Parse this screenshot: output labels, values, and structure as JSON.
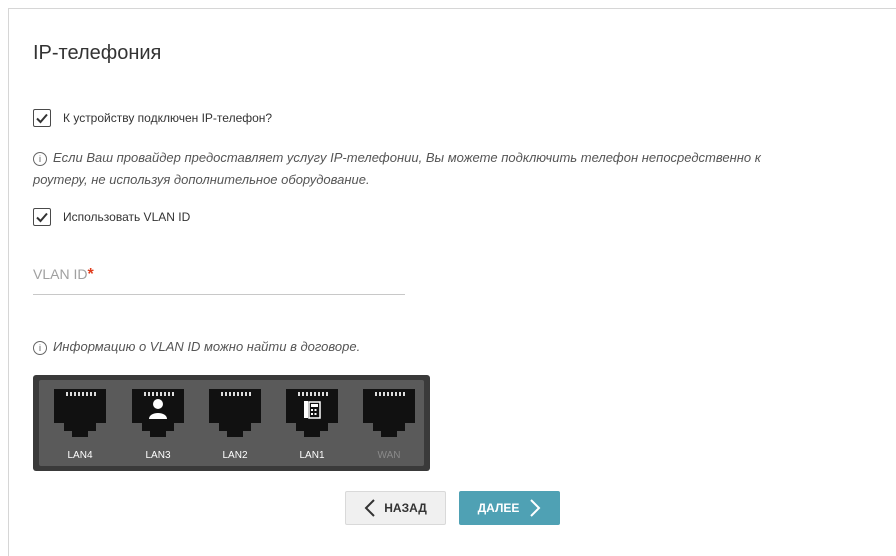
{
  "page": {
    "title": "IP-телефония",
    "phone_checkbox": {
      "label": "К устройству подключен IP-телефон?",
      "checked": true
    },
    "info_provider": {
      "line1": "Если Ваш провайдер предоставляет услугу IP-телефонии, Вы можете подключить телефон непосредственно к",
      "line2": "роутеру, не используя дополнительное оборудование."
    },
    "vlan_checkbox": {
      "label": "Использовать VLAN ID",
      "checked": true
    },
    "vlan_field": {
      "placeholder": "VLAN ID",
      "required_mark": "*",
      "value": ""
    },
    "info_vlan": "Информацию о VLAN ID можно найти в договоре.",
    "ports": [
      {
        "label": "LAN4",
        "icon": "none",
        "active": true
      },
      {
        "label": "LAN3",
        "icon": "user-icon",
        "active": true
      },
      {
        "label": "LAN2",
        "icon": "none",
        "active": true
      },
      {
        "label": "LAN1",
        "icon": "phone-icon",
        "active": true
      },
      {
        "label": "WAN",
        "icon": "none",
        "active": false
      }
    ],
    "buttons": {
      "back": "НАЗАД",
      "next": "ДАЛЕЕ"
    },
    "colors": {
      "accent": "#4fa1b4",
      "required": "#e03c1c",
      "panel": "#3a3a3a"
    },
    "info_icon_glyph": "i"
  }
}
